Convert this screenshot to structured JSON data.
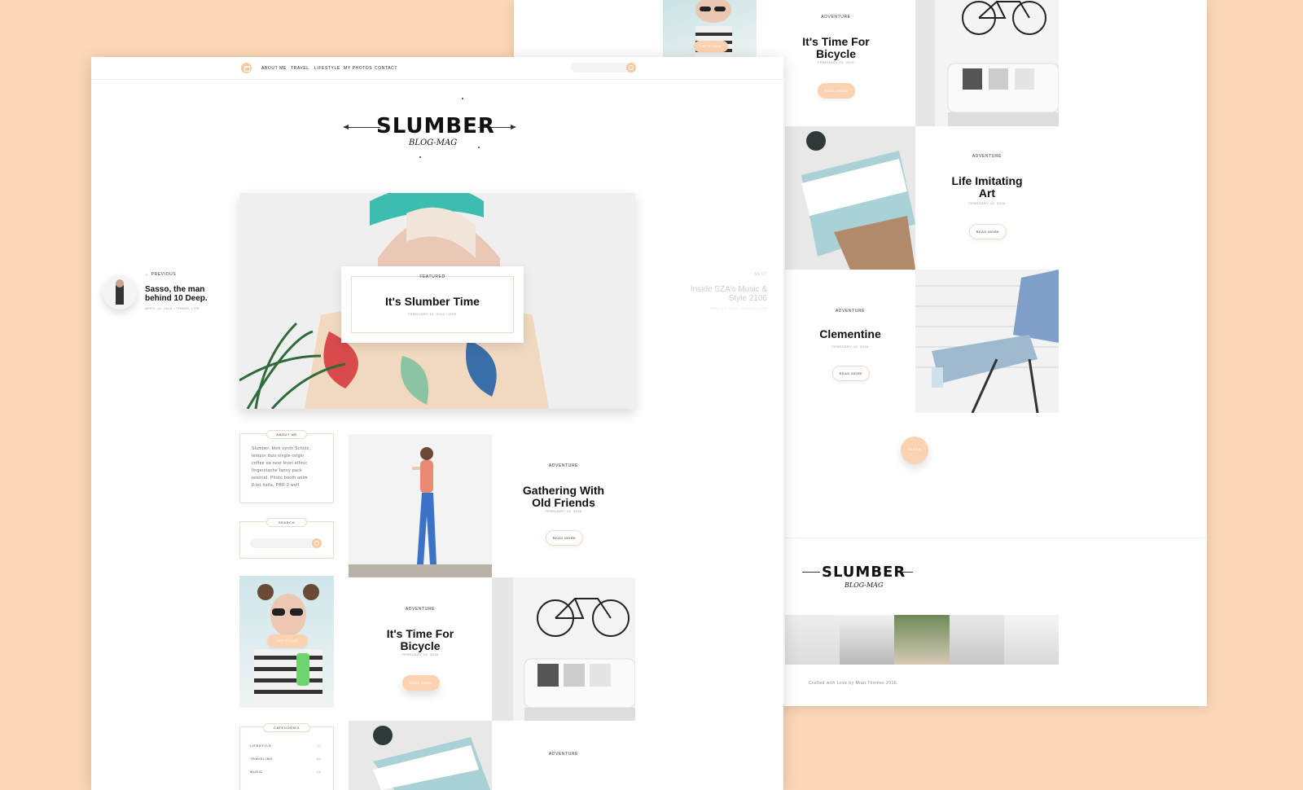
{
  "colors": {
    "background": "#fcd7b7",
    "accent": "#f9c8a0",
    "card_border": "#f3d9c6"
  },
  "nav": {
    "home_icon": "home-icon",
    "items": [
      "ABOUT ME",
      "TRAVEL",
      "LIFESTYLE",
      "MY PHOTOS",
      "CONTACT"
    ],
    "search_icon": "search-icon"
  },
  "logo": {
    "title": "SLUMBER",
    "subtitle": "BLOG-MAG"
  },
  "featured": {
    "category": "FEATURED",
    "title": "It's Slumber Time",
    "date": "FEBRUARY 15, 2016",
    "tag": "LIFE"
  },
  "prev_post": {
    "label": "PREVIOUS",
    "title_line1": "Sasso, the man",
    "title_line2": "behind 10 Deep.",
    "date": "APRIL 14, 2016 / TRAVEL LIFE"
  },
  "next_post": {
    "label": "NEXT",
    "title_line1": "Inside SZA's Music &",
    "title_line2": "Style 2106",
    "date": "APRIL 14, 2016 / FASHION LIFE"
  },
  "sidebar": {
    "about_title": "ABOUT ME",
    "about_lines": [
      "Slumber. Meh synth Schlitz,",
      "tempor duis single-origin",
      "coffee ea next level ethnic",
      "fingerstache fanny pack",
      "nostrud. Photo booth anim",
      "8-bit hella, PBR 3 wolf"
    ],
    "search_title": "SEARCH",
    "promo_label": "LET'S TALK",
    "categories_title": "CATEGORIES",
    "categories": [
      {
        "name": "LIFESTYLE",
        "count": "(7)"
      },
      {
        "name": "TRAVELING",
        "count": "(5)"
      },
      {
        "name": "MUSIC",
        "count": "(3)"
      }
    ]
  },
  "posts_front": [
    {
      "category": "ADVENTURE",
      "title_line1": "Gathering With",
      "title_line2": "Old Friends",
      "date": "FEBRUARY 15, 2016",
      "button": "READ MORE"
    },
    {
      "category": "ADVENTURE",
      "title_line1": "It's Time For",
      "title_line2": "Bicycle",
      "date": "FEBRUARY 15, 2016",
      "button": "READ MORE"
    },
    {
      "category": "ADVENTURE"
    }
  ],
  "posts_back": [
    {
      "category": "ADVENTURE",
      "title_line1": "It's Time For",
      "title_line2": "Bicycle",
      "date": "FEBRUARY 15, 2016",
      "button": "READ MORE"
    },
    {
      "category": "ADVENTURE",
      "title_line1": "Life Imitating",
      "title_line2": "Art",
      "date": "FEBRUARY 15, 2016",
      "button": "READ MORE"
    },
    {
      "category": "ADVENTURE",
      "title_line1": "Clementine",
      "date": "FEBRUARY 15, 2016",
      "button": "READ MORE"
    }
  ],
  "load_more": "OLDER",
  "footer": {
    "credit": "Crafted with Love by Mian Themes 2016."
  }
}
